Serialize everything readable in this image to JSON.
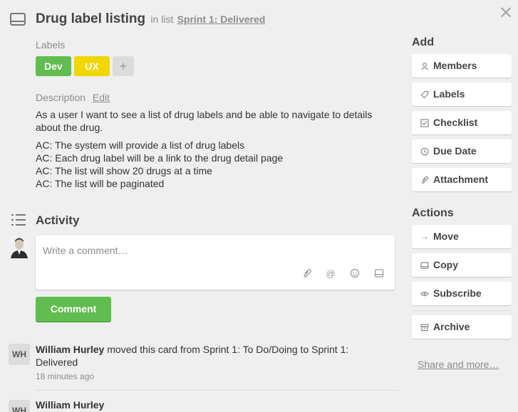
{
  "card": {
    "title": "Drug label listing",
    "in_list_prefix": "in list",
    "list_name": "Sprint 1: Delivered"
  },
  "labels": {
    "heading": "Labels",
    "items": [
      {
        "text": "Dev",
        "color": "#61bd4f"
      },
      {
        "text": "UX",
        "color": "#f2d600"
      }
    ],
    "add": "+"
  },
  "description": {
    "heading": "Description",
    "edit": "Edit",
    "intro": "As a user I want to see a list of drug labels and be able to navigate to details about the drug.",
    "criteria": [
      "AC: The system will provide a list of drug labels",
      "AC: Each drug label will be a link to the drug detail page",
      "AC: The list will show 20 drugs at a time",
      "AC: The list will be paginated"
    ]
  },
  "activity": {
    "heading": "Activity",
    "comment_placeholder": "Write a comment…",
    "comment_button": "Comment",
    "entries": [
      {
        "initials": "WH",
        "author": "William Hurley",
        "action": "moved this card from Sprint 1: To Do/Doing to Sprint 1: Delivered",
        "time": "18 minutes ago"
      },
      {
        "initials": "WH",
        "author": "William Hurley"
      }
    ]
  },
  "sidebar": {
    "add_heading": "Add",
    "add_items": [
      {
        "label": "Members",
        "icon": "person-icon"
      },
      {
        "label": "Labels",
        "icon": "tag-icon"
      },
      {
        "label": "Checklist",
        "icon": "checkbox-icon"
      },
      {
        "label": "Due Date",
        "icon": "clock-icon"
      },
      {
        "label": "Attachment",
        "icon": "paperclip-icon"
      }
    ],
    "actions_heading": "Actions",
    "action_items": [
      {
        "label": "Move",
        "icon": "arrow-right-icon"
      },
      {
        "label": "Copy",
        "icon": "card-icon"
      },
      {
        "label": "Subscribe",
        "icon": "eye-icon"
      },
      {
        "label": "Archive",
        "icon": "archive-icon"
      }
    ],
    "share": "Share and more…"
  },
  "colors": {
    "background": "#efefef",
    "green": "#61bd4f",
    "yellow": "#f2d600",
    "muted_text": "#8c8c8c"
  }
}
